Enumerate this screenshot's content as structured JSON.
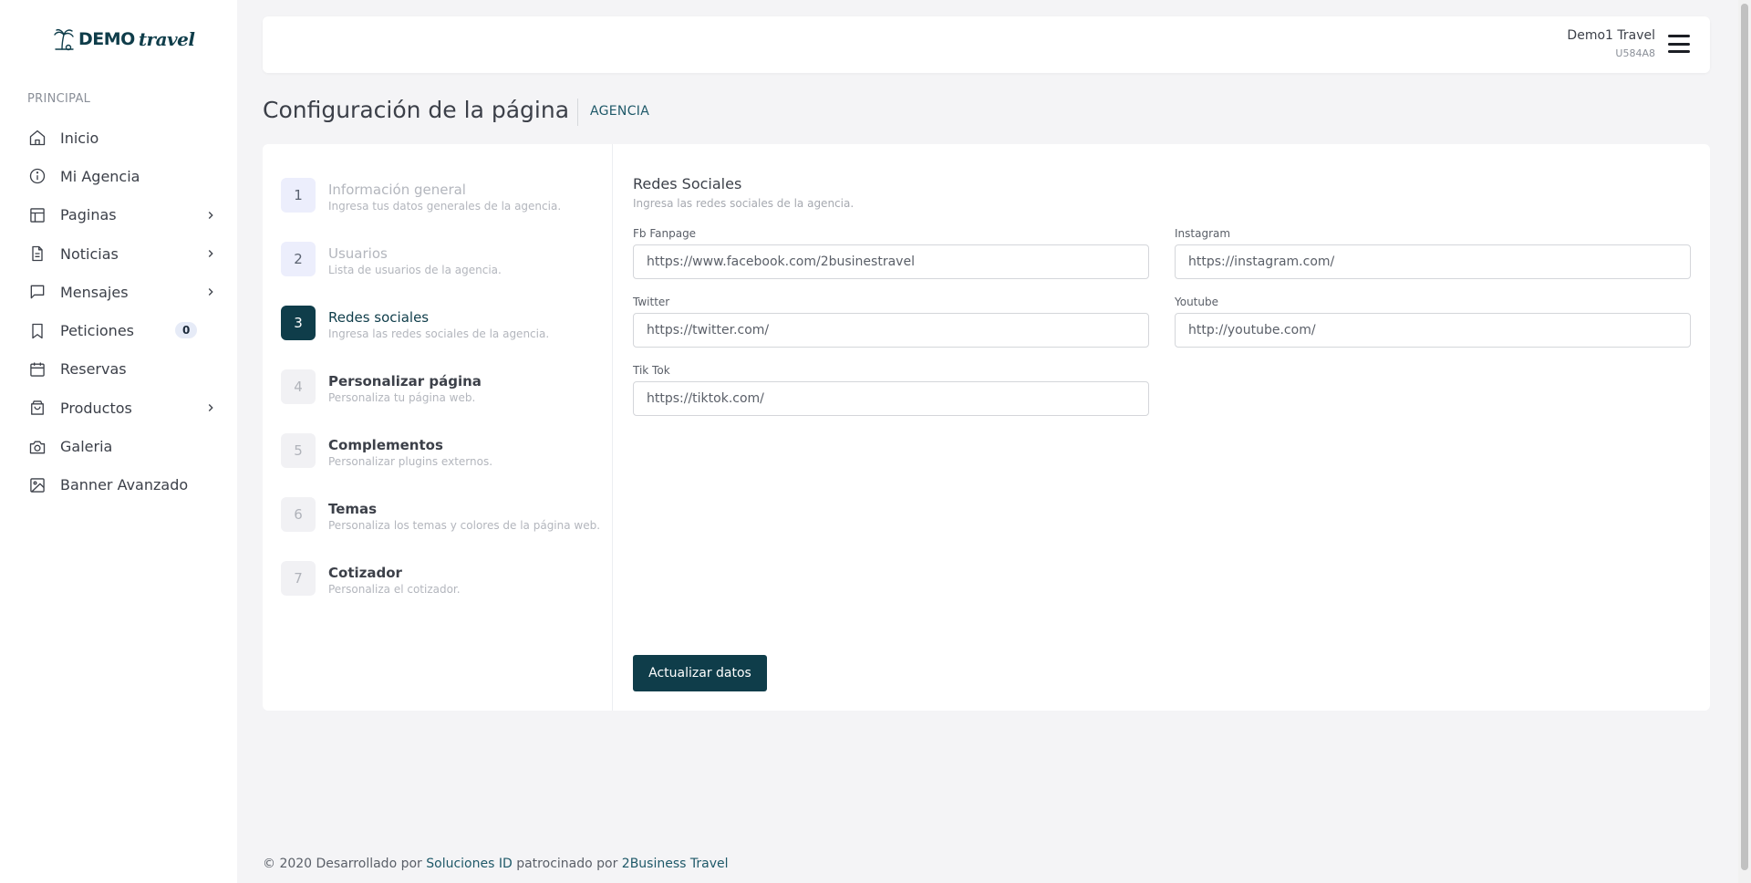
{
  "brand": {
    "demo": "DEMO",
    "travel": "travel"
  },
  "sidebar": {
    "section": "PRINCIPAL",
    "items": [
      {
        "label": "Inicio",
        "icon": "home-icon",
        "chevron": false
      },
      {
        "label": "Mi Agencia",
        "icon": "info-icon",
        "chevron": false
      },
      {
        "label": "Paginas",
        "icon": "layout-icon",
        "chevron": true
      },
      {
        "label": "Noticias",
        "icon": "document-icon",
        "chevron": true
      },
      {
        "label": "Mensajes",
        "icon": "message-icon",
        "chevron": true
      },
      {
        "label": "Peticiones",
        "icon": "bookmark-icon",
        "chevron": false,
        "badge": "0"
      },
      {
        "label": "Reservas",
        "icon": "calendar-icon",
        "chevron": false
      },
      {
        "label": "Productos",
        "icon": "shopping-bag-icon",
        "chevron": true
      },
      {
        "label": "Galeria",
        "icon": "camera-icon",
        "chevron": false
      },
      {
        "label": "Banner Avanzado",
        "icon": "image-icon",
        "chevron": false
      }
    ]
  },
  "header": {
    "user_name": "Demo1 Travel",
    "user_code": "U584A8"
  },
  "page": {
    "title": "Configuración de la página",
    "breadcrumb": "AGENCIA"
  },
  "steps": [
    {
      "num": "1",
      "title": "Información general",
      "sub": "Ingresa tus datos generales de la agencia.",
      "state": "done"
    },
    {
      "num": "2",
      "title": "Usuarios",
      "sub": "Lista de usuarios de la agencia.",
      "state": "done"
    },
    {
      "num": "3",
      "title": "Redes sociales",
      "sub": "Ingresa las redes sociales de la agencia.",
      "state": "active"
    },
    {
      "num": "4",
      "title": "Personalizar página",
      "sub": "Personaliza tu página web.",
      "state": "pending"
    },
    {
      "num": "5",
      "title": "Complementos",
      "sub": "Personalizar plugins externos.",
      "state": "pending"
    },
    {
      "num": "6",
      "title": "Temas",
      "sub": "Personaliza los temas y colores de la página web.",
      "state": "pending"
    },
    {
      "num": "7",
      "title": "Cotizador",
      "sub": "Personaliza el cotizador.",
      "state": "pending"
    }
  ],
  "form": {
    "title": "Redes Sociales",
    "subtitle": "Ingresa las redes sociales de la agencia.",
    "fields": {
      "fb": {
        "label": "Fb Fanpage",
        "value": "https://www.facebook.com/2businestravel"
      },
      "instagram": {
        "label": "Instagram",
        "value": "https://instagram.com/"
      },
      "twitter": {
        "label": "Twitter",
        "value": "https://twitter.com/"
      },
      "youtube": {
        "label": "Youtube",
        "value": "http://youtube.com/"
      },
      "tiktok": {
        "label": "Tik Tok",
        "value": "https://tiktok.com/"
      }
    },
    "submit_label": "Actualizar datos"
  },
  "footer": {
    "prefix": "© 2020 Desarrollado por",
    "link1": "Soluciones ID",
    "middle": "patrocinado por",
    "link2": "2Business Travel"
  },
  "colors": {
    "primary": "#0f3d4a",
    "accent_text": "#1e5868",
    "background": "#f4f4f6"
  }
}
